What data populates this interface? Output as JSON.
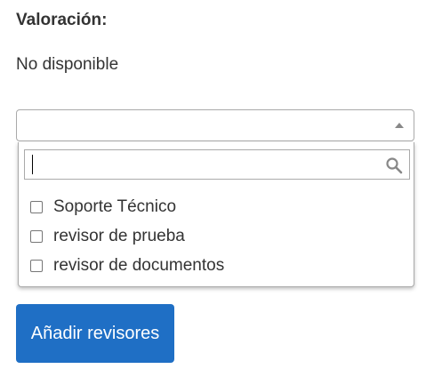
{
  "rating": {
    "label": "Valoración:",
    "value": "No disponible"
  },
  "reviewer_select": {
    "search": {
      "value": "",
      "placeholder": ""
    },
    "options": [
      {
        "label": "Soporte Técnico",
        "checked": false
      },
      {
        "label": "revisor de prueba",
        "checked": false
      },
      {
        "label": "revisor de documentos",
        "checked": false
      }
    ]
  },
  "actions": {
    "add_reviewers_label": "Añadir revisores"
  },
  "colors": {
    "primary_button": "#1f6fc5",
    "border": "#aaaaaa"
  },
  "icons": {
    "search": "search-icon",
    "dropdown": "caret-up-icon"
  }
}
